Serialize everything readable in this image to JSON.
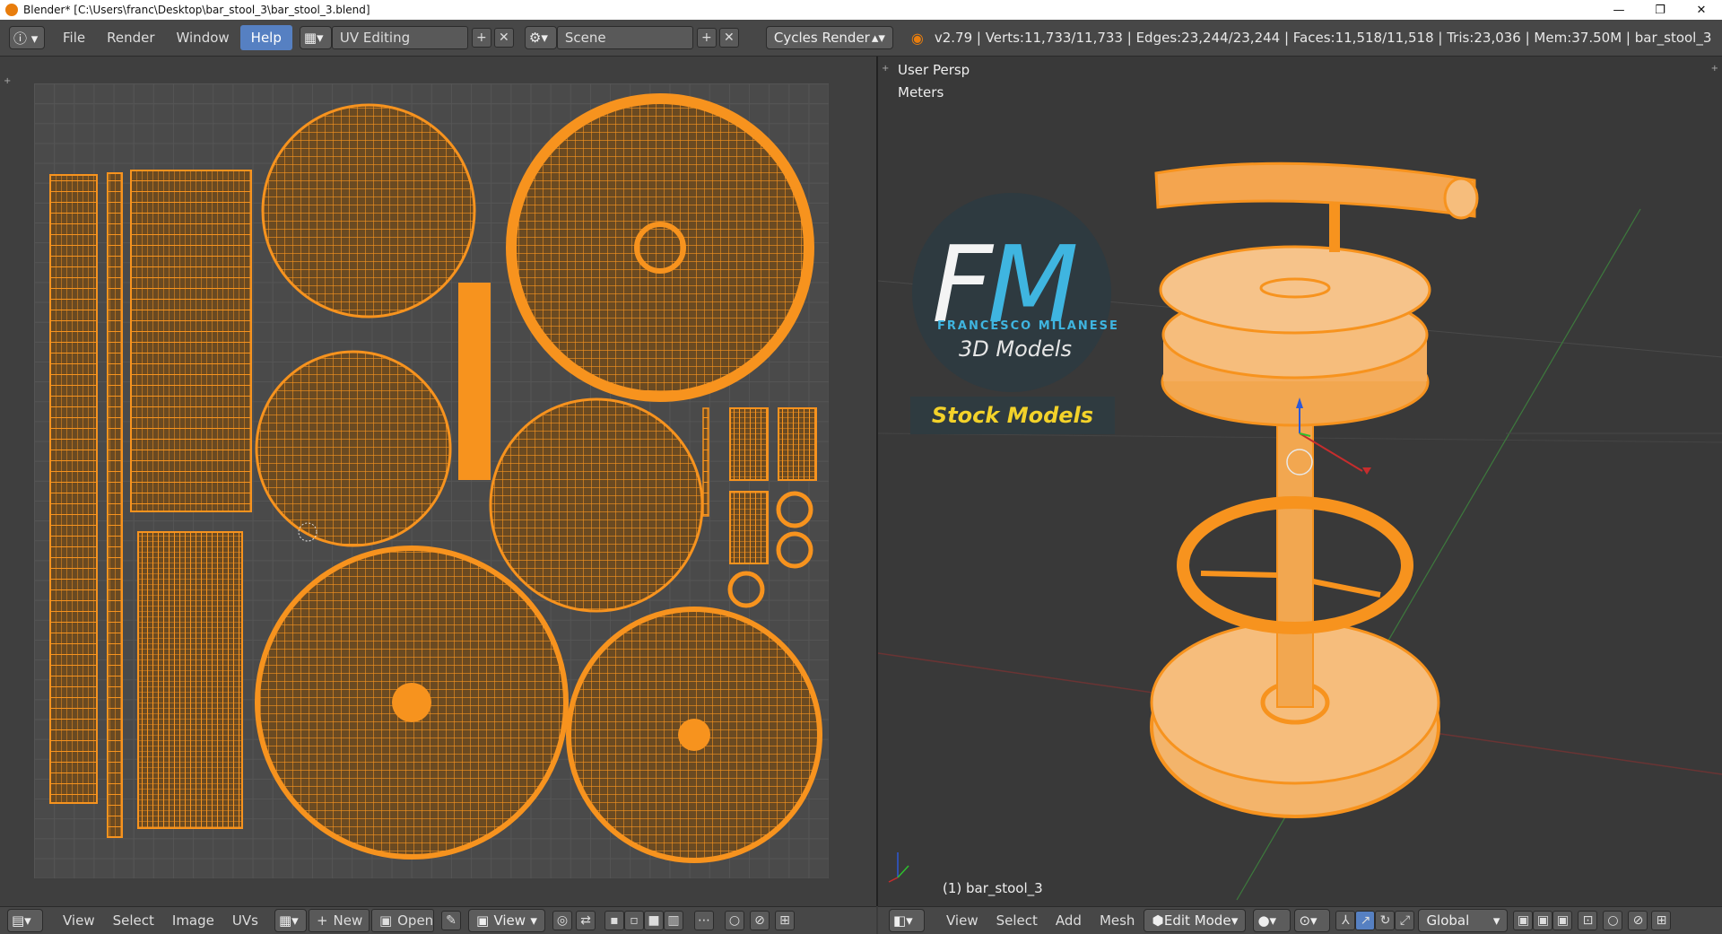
{
  "window": {
    "title": "Blender* [C:\\Users\\franc\\Desktop\\bar_stool_3\\bar_stool_3.blend]",
    "controls": [
      "—",
      "❐",
      "✕"
    ]
  },
  "header": {
    "menus": [
      "File",
      "Render",
      "Window",
      "Help"
    ],
    "active_menu": "Help",
    "layout": "UV Editing",
    "scene": "Scene",
    "engine": "Cycles Render",
    "stats": "v2.79 | Verts:11,733/11,733 | Edges:23,244/23,244 | Faces:11,518/11,518 | Tris:23,036 | Mem:37.50M | bar_stool_3"
  },
  "uv_editor": {
    "menus": [
      "View",
      "Select",
      "Image",
      "UVs"
    ],
    "new_label": "New",
    "open_label": "Open",
    "view_label": "View"
  },
  "viewport": {
    "view_label": "User Persp",
    "units_label": "Meters",
    "object_label": "(1) bar_stool_3",
    "menus": [
      "View",
      "Select",
      "Add",
      "Mesh"
    ],
    "mode": "Edit Mode",
    "orientation": "Global"
  },
  "watermark": {
    "logo_text": "FM",
    "name": "FRANCESCO MILANESE",
    "subtitle": "3D Models",
    "banner": "Stock Models"
  },
  "colors": {
    "mesh_orange": "#f7931e",
    "active_blue": "#5680c2",
    "logo_blue": "#3fb5e0",
    "banner_yellow": "#f3d22a"
  }
}
